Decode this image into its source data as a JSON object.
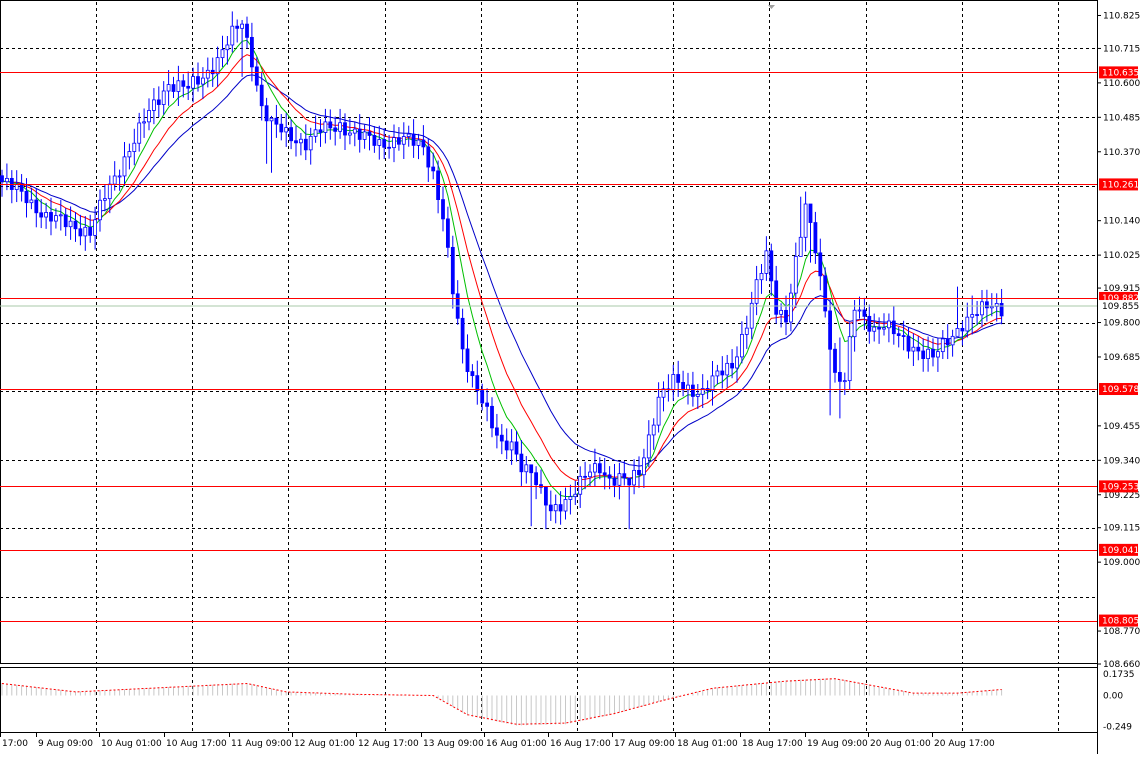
{
  "chart_data": {
    "type": "candlestick",
    "main_panel": {
      "ylim": [
        108.66,
        110.87
      ],
      "y_ticks": [
        "110.825",
        "110.715",
        "110.600",
        "110.485",
        "110.370",
        "110.140",
        "110.025",
        "109.915",
        "109.800",
        "109.685",
        "109.455",
        "109.340",
        "109.225",
        "109.115",
        "109.000",
        "108.770",
        "108.660"
      ],
      "current_price": "109.855",
      "levels": [
        "110.635",
        "110.261",
        "109.882",
        "109.578",
        "109.253",
        "109.041",
        "108.805"
      ],
      "level_color": "#ff0000",
      "ma_colors": {
        "fast": "#00c000",
        "mid": "#ff0000",
        "slow": "#0000c8"
      },
      "close_path": [
        [
          0,
          110.27
        ],
        [
          5,
          110.22
        ],
        [
          9,
          110.15
        ],
        [
          14,
          110.13
        ],
        [
          18,
          110.1
        ],
        [
          21,
          110.22
        ],
        [
          25,
          110.35
        ],
        [
          30,
          110.5
        ],
        [
          34,
          110.6
        ],
        [
          38,
          110.58
        ],
        [
          41,
          110.62
        ],
        [
          44,
          110.68
        ],
        [
          47,
          110.76
        ],
        [
          49,
          110.8
        ],
        [
          51,
          110.68
        ],
        [
          53,
          110.52
        ],
        [
          55,
          110.46
        ],
        [
          58,
          110.43
        ],
        [
          62,
          110.4
        ],
        [
          65,
          110.44
        ],
        [
          69,
          110.46
        ],
        [
          73,
          110.42
        ],
        [
          77,
          110.4
        ],
        [
          82,
          110.41
        ],
        [
          86,
          110.39
        ],
        [
          88,
          110.3
        ],
        [
          90,
          110.15
        ],
        [
          92,
          109.9
        ],
        [
          94,
          109.7
        ],
        [
          96,
          109.62
        ],
        [
          98,
          109.55
        ],
        [
          100,
          109.45
        ],
        [
          102,
          109.38
        ],
        [
          104,
          109.4
        ],
        [
          106,
          109.33
        ],
        [
          108,
          109.3
        ],
        [
          110,
          109.22
        ],
        [
          112,
          109.17
        ],
        [
          114,
          109.2
        ],
        [
          116,
          109.22
        ],
        [
          118,
          109.26
        ],
        [
          120,
          109.3
        ],
        [
          122,
          109.32
        ],
        [
          124,
          109.28
        ],
        [
          126,
          109.28
        ],
        [
          128,
          109.26
        ],
        [
          130,
          109.3
        ],
        [
          132,
          109.42
        ],
        [
          134,
          109.55
        ],
        [
          137,
          109.6
        ],
        [
          140,
          109.58
        ],
        [
          143,
          109.57
        ],
        [
          146,
          109.62
        ],
        [
          149,
          109.66
        ],
        [
          152,
          109.8
        ],
        [
          154,
          109.92
        ],
        [
          156,
          110.02
        ],
        [
          158,
          109.85
        ],
        [
          160,
          109.82
        ],
        [
          162,
          110.0
        ],
        [
          164,
          110.18
        ],
        [
          166,
          110.05
        ],
        [
          168,
          109.85
        ],
        [
          170,
          109.62
        ],
        [
          172,
          109.6
        ],
        [
          174,
          109.85
        ],
        [
          176,
          109.82
        ],
        [
          178,
          109.78
        ],
        [
          180,
          109.79
        ],
        [
          183,
          109.75
        ],
        [
          186,
          109.72
        ],
        [
          188,
          109.7
        ],
        [
          190,
          109.68
        ],
        [
          192,
          109.72
        ],
        [
          194,
          109.76
        ],
        [
          196,
          109.8
        ],
        [
          198,
          109.82
        ],
        [
          200,
          109.84
        ],
        [
          202,
          109.86
        ],
        [
          204,
          109.85
        ]
      ],
      "extra_extremes": [
        [
          49,
          110.81,
          110.62
        ],
        [
          54,
          110.55,
          110.33
        ],
        [
          55,
          110.49,
          110.3
        ],
        [
          108,
          109.3,
          109.12
        ],
        [
          111,
          109.24,
          109.11
        ],
        [
          128,
          109.27,
          109.11
        ],
        [
          163,
          110.22,
          110.05
        ],
        [
          165,
          110.18,
          110.0
        ],
        [
          169,
          109.88,
          109.49
        ],
        [
          171,
          109.75,
          109.48
        ],
        [
          195,
          109.92,
          109.78
        ],
        [
          198,
          109.89,
          109.76
        ]
      ],
      "candle_count": 205
    },
    "oscillator": {
      "y_ticks": [
        "0.1735",
        "0.00",
        "-0.249"
      ],
      "ylim": [
        -0.3,
        0.22
      ],
      "histogram_color": "#c8c8c8",
      "signal_color": "#ff0000",
      "path": [
        [
          0,
          0.1
        ],
        [
          15,
          0.03
        ],
        [
          35,
          0.07
        ],
        [
          50,
          0.1
        ],
        [
          58,
          0.03
        ],
        [
          72,
          0.01
        ],
        [
          88,
          0.0
        ],
        [
          95,
          -0.16
        ],
        [
          105,
          -0.24
        ],
        [
          115,
          -0.23
        ],
        [
          125,
          -0.15
        ],
        [
          135,
          -0.04
        ],
        [
          145,
          0.06
        ],
        [
          160,
          0.12
        ],
        [
          170,
          0.14
        ],
        [
          178,
          0.08
        ],
        [
          186,
          0.02
        ],
        [
          195,
          0.02
        ],
        [
          204,
          0.05
        ]
      ]
    },
    "x_tick_labels": [
      "17:00",
      "9 Aug 09:00",
      "10 Aug 01:00",
      "10 Aug 17:00",
      "11 Aug 09:00",
      "12 Aug 01:00",
      "12 Aug 17:00",
      "13 Aug 09:00",
      "16 Aug 01:00",
      "16 Aug 17:00",
      "17 Aug 09:00",
      "18 Aug 01:00",
      "18 Aug 17:00",
      "19 Aug 09:00",
      "20 Aug 01:00",
      "20 Aug 17:00"
    ],
    "grid": true,
    "colors": {
      "candle": "#0000ff",
      "grid": "#000000",
      "background": "#ffffff"
    }
  }
}
